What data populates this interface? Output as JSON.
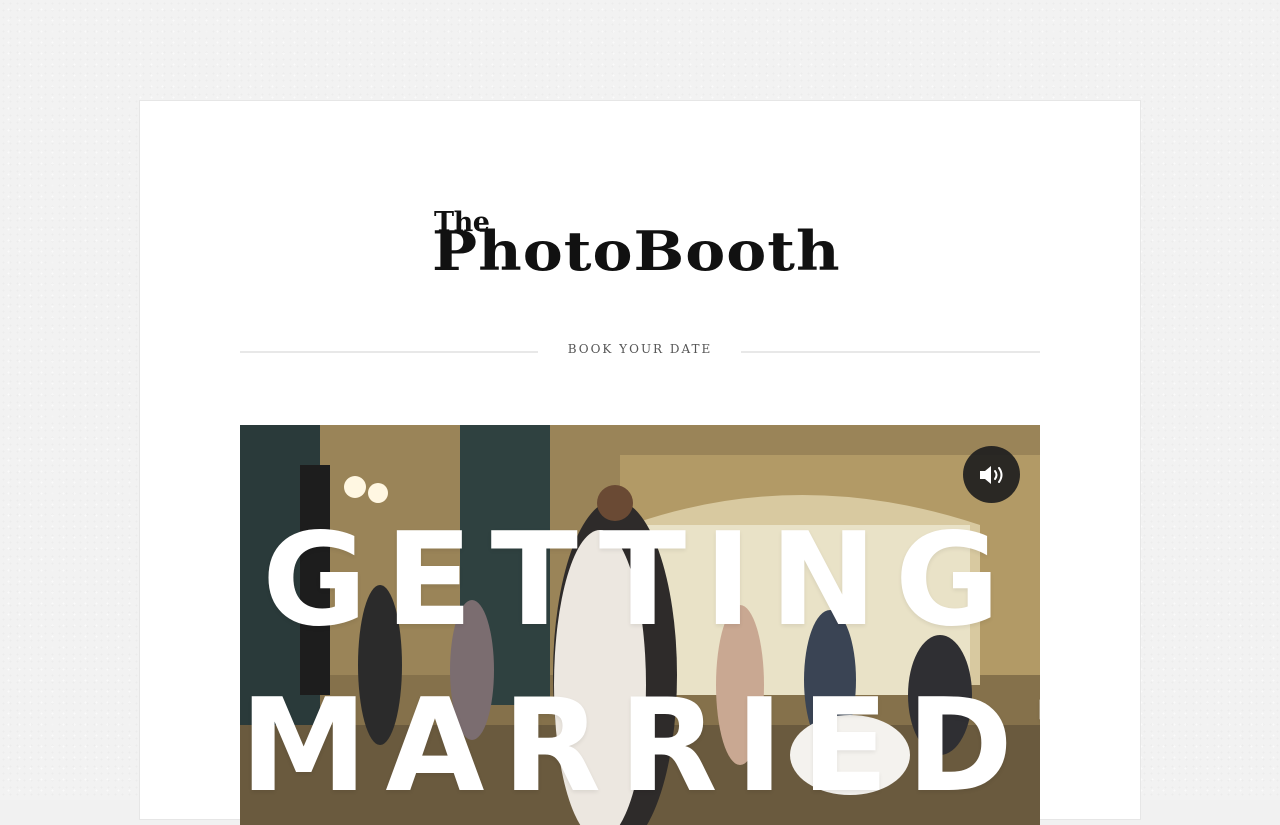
{
  "brand": {
    "small": "The",
    "name": "PhotoBooth"
  },
  "nav": {
    "link_label": "BOOK YOUR DATE"
  },
  "hero": {
    "line1": "GETTING",
    "line2": "MARRIED?",
    "sound_icon": "speaker-volume-icon"
  },
  "colors": {
    "page_bg": "#f2f2f2",
    "card_bg": "#ffffff",
    "text": "#111111",
    "nav_text": "#555555",
    "hero_text": "#ffffff",
    "sound_button": "#1e1e1e"
  }
}
